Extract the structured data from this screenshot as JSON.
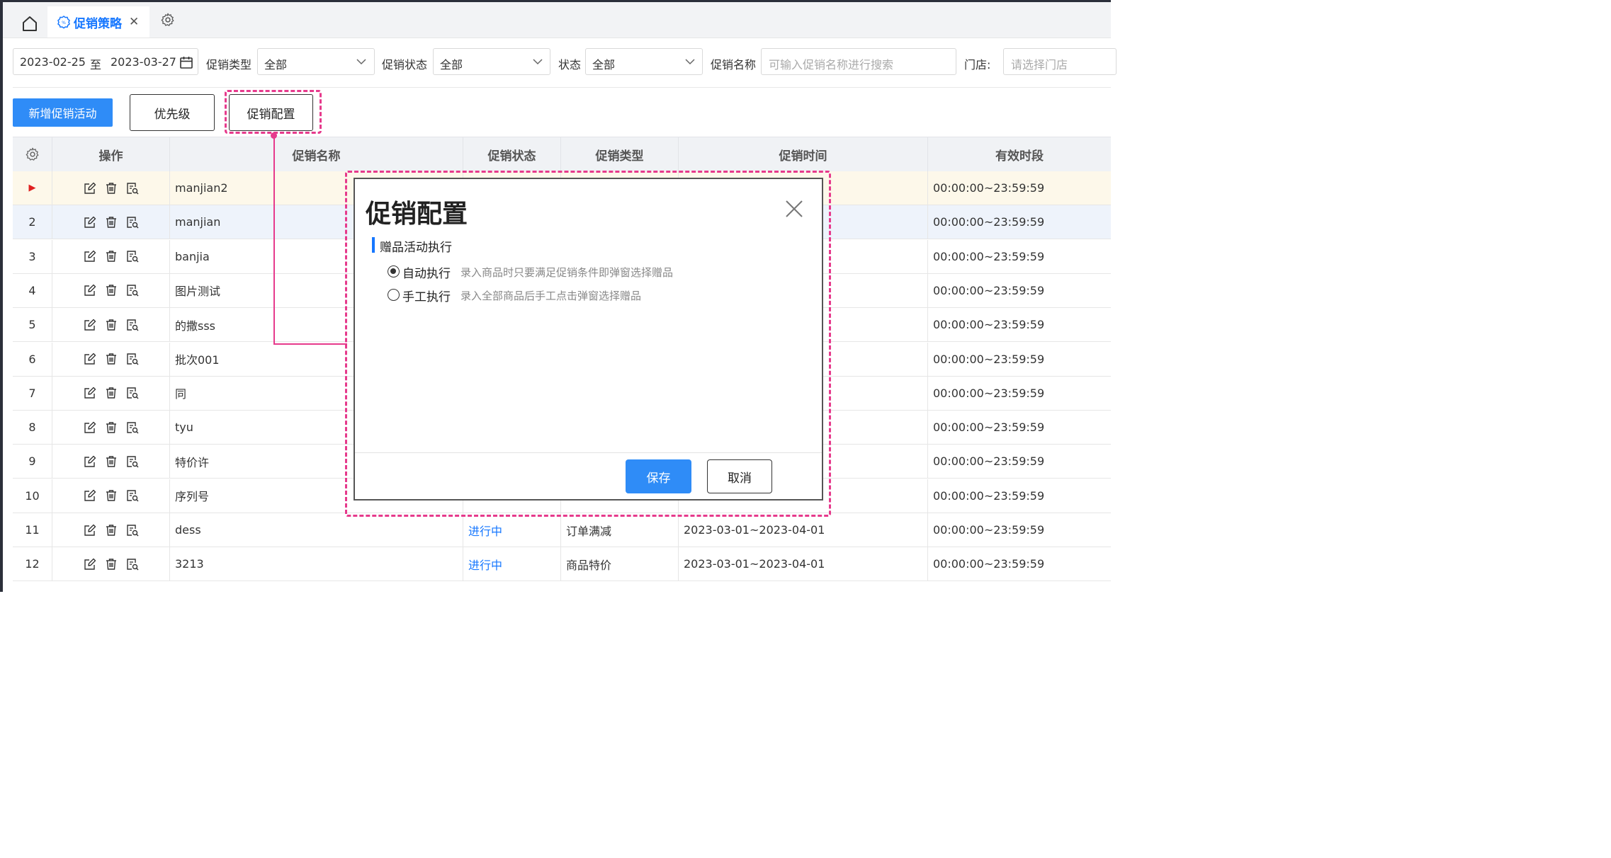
{
  "tabs": {
    "active_label": "促销策略",
    "close_glyph": "✕"
  },
  "filters": {
    "date_start": "2023-02-25",
    "date_sep": "至",
    "date_end": "2023-03-27",
    "promo_type_label": "促销类型",
    "promo_type_value": "全部",
    "promo_status_label": "促销状态",
    "promo_status_value": "全部",
    "status_label": "状态",
    "status_value": "全部",
    "promo_name_label": "促销名称",
    "promo_name_placeholder": "可输入促销名称进行搜索",
    "store_label": "门店:",
    "store_placeholder": "请选择门店"
  },
  "toolbar": {
    "add_label": "新增促销活动",
    "priority_label": "优先级",
    "config_label": "促销配置"
  },
  "table": {
    "headers": {
      "ops": "操作",
      "name": "促销名称",
      "status": "促销状态",
      "type": "促销类型",
      "time": "促销时间",
      "valid": "有效时段"
    },
    "rows": [
      {
        "idx": "▶",
        "name": "manjian2",
        "status": "",
        "type": "",
        "time": "",
        "valid": "00:00:00~23:59:59"
      },
      {
        "idx": "2",
        "name": "manjian",
        "status": "",
        "type": "",
        "time": "",
        "valid": "00:00:00~23:59:59"
      },
      {
        "idx": "3",
        "name": "banjia",
        "status": "",
        "type": "",
        "time": "",
        "valid": "00:00:00~23:59:59"
      },
      {
        "idx": "4",
        "name": "图片测试",
        "status": "",
        "type": "",
        "time": "",
        "valid": "00:00:00~23:59:59"
      },
      {
        "idx": "5",
        "name": "的撒sss",
        "status": "",
        "type": "",
        "time": "",
        "valid": "00:00:00~23:59:59"
      },
      {
        "idx": "6",
        "name": "批次001",
        "status": "",
        "type": "",
        "time": "",
        "valid": "00:00:00~23:59:59"
      },
      {
        "idx": "7",
        "name": "同",
        "status": "",
        "type": "",
        "time": "",
        "valid": "00:00:00~23:59:59"
      },
      {
        "idx": "8",
        "name": "tyu",
        "status": "",
        "type": "",
        "time": "",
        "valid": "00:00:00~23:59:59"
      },
      {
        "idx": "9",
        "name": "特价许",
        "status": "",
        "type": "",
        "time": "",
        "valid": "00:00:00~23:59:59"
      },
      {
        "idx": "10",
        "name": "序列号",
        "status": "",
        "type": "",
        "time": "",
        "valid": "00:00:00~23:59:59"
      },
      {
        "idx": "11",
        "name": "dess",
        "status": "进行中",
        "type": "订单满减",
        "time": "2023-03-01~2023-04-01",
        "valid": "00:00:00~23:59:59"
      },
      {
        "idx": "12",
        "name": "3213",
        "status": "进行中",
        "type": "商品特价",
        "time": "2023-03-01~2023-04-01",
        "valid": "00:00:00~23:59:59"
      }
    ]
  },
  "modal": {
    "title": "促销配置",
    "section_title": "赠品活动执行",
    "option_auto_label": "自动执行",
    "option_auto_desc": "录入商品时只要满足促销条件即弹窗选择赠品",
    "option_manual_label": "手工执行",
    "option_manual_desc": "录入全部商品后手工点击弹窗选择赠品",
    "selected_option": "自动执行",
    "save_label": "保存",
    "cancel_label": "取消"
  },
  "colors": {
    "primary": "#2f8cf7",
    "highlight": "#e63a8c",
    "active_row": "#fdf8ea",
    "selected_row": "#eef3fb"
  }
}
